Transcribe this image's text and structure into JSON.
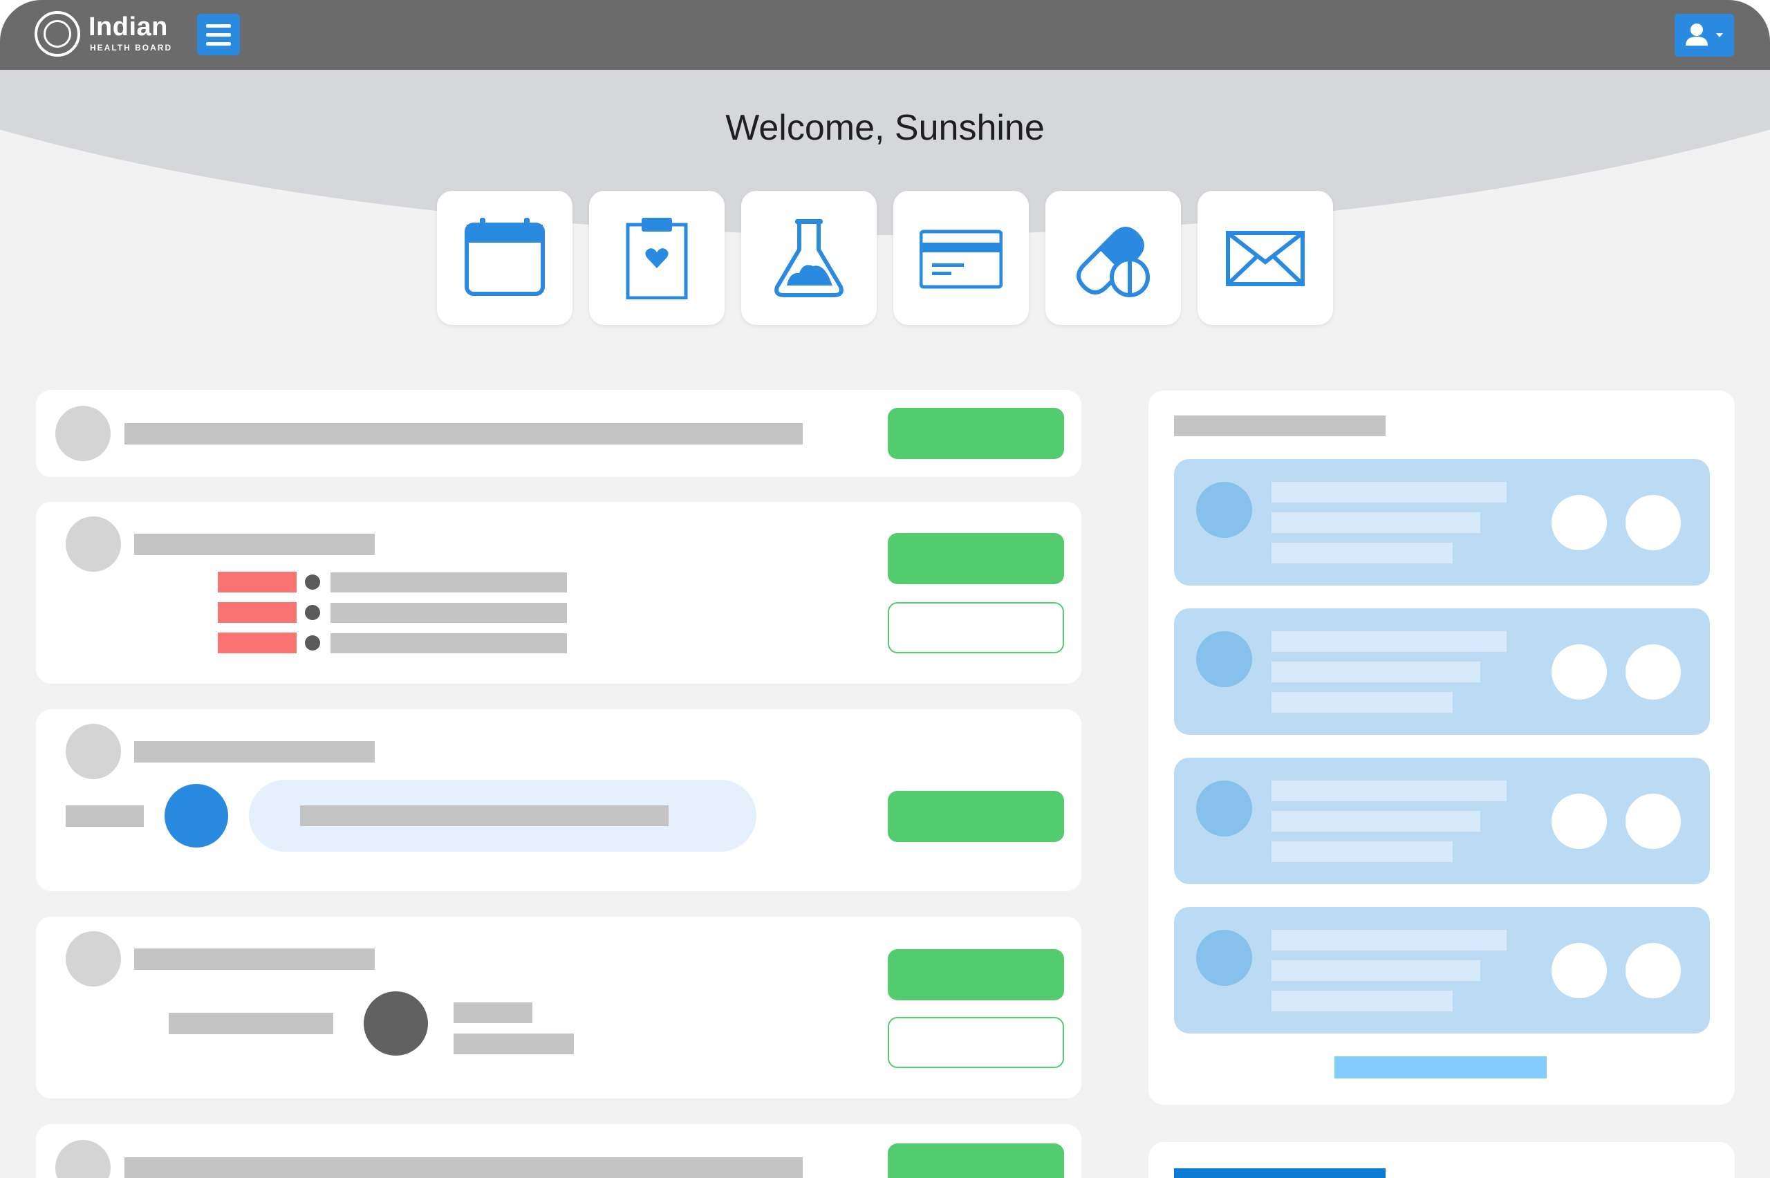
{
  "header": {
    "logo_title": "Indian",
    "logo_subtitle": "HEALTH BOARD",
    "menu_icon": "hamburger-icon",
    "user_icon": "user-icon"
  },
  "hero": {
    "welcome_text": "Welcome, Sunshine"
  },
  "quick_actions": [
    {
      "icon": "calendar-icon"
    },
    {
      "icon": "clipboard-heart-icon"
    },
    {
      "icon": "lab-flask-icon"
    },
    {
      "icon": "credit-card-icon"
    },
    {
      "icon": "pills-icon"
    },
    {
      "icon": "mail-icon"
    }
  ],
  "colors": {
    "topbar": "#6b6b6b",
    "accent_blue": "#2a8ae0",
    "success_green": "#52cc6e",
    "alert_red": "#f97373",
    "light_blue_card": "#bbdbf4",
    "sidebar_link": "#84ccfb",
    "dark_blue_bar": "#0a7bd4"
  }
}
